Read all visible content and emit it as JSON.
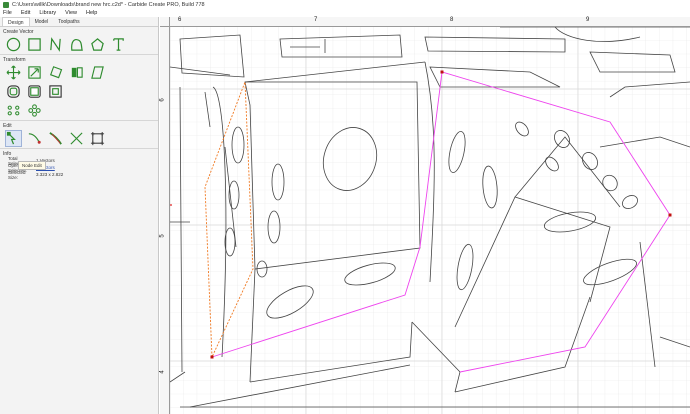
{
  "window": {
    "title": "C:\\Users\\willk\\Downloads\\brand new hrc.c2d* - Carbide Create PRO, Build 778"
  },
  "menu": {
    "items": [
      "File",
      "Edit",
      "Library",
      "View",
      "Help"
    ]
  },
  "sidebar": {
    "tabs": [
      "Design",
      "Model",
      "Toolpaths"
    ],
    "create_vector": {
      "header": "Create Vector",
      "tools": [
        "circle-tool-icon",
        "rectangle-tool-icon",
        "polyline-tool-icon",
        "curve-tool-icon",
        "polygon-tool-icon",
        "text-tool-icon"
      ]
    },
    "transform": {
      "header": "Transform"
    },
    "edit": {
      "header": "Edit",
      "tooltip": "Node Edit"
    },
    "info": {
      "header": "Info",
      "rows": [
        {
          "label": "Total Selected:",
          "value": "1 Vectors"
        },
        {
          "label": "Open Selected:",
          "value": "1 Vectors"
        },
        {
          "label": "Selected Size:",
          "value": "3.323 x 2.822"
        }
      ]
    }
  },
  "ruler": {
    "top_labels": [
      "6",
      "7",
      "8",
      "9"
    ],
    "left_labels": [
      "6",
      "5",
      "4"
    ]
  },
  "colors": {
    "accent_green": "#3a8a3a",
    "selection_orange": "#f07820",
    "selection_magenta": "#ee44ee",
    "ruler_marker": "#e02020"
  }
}
